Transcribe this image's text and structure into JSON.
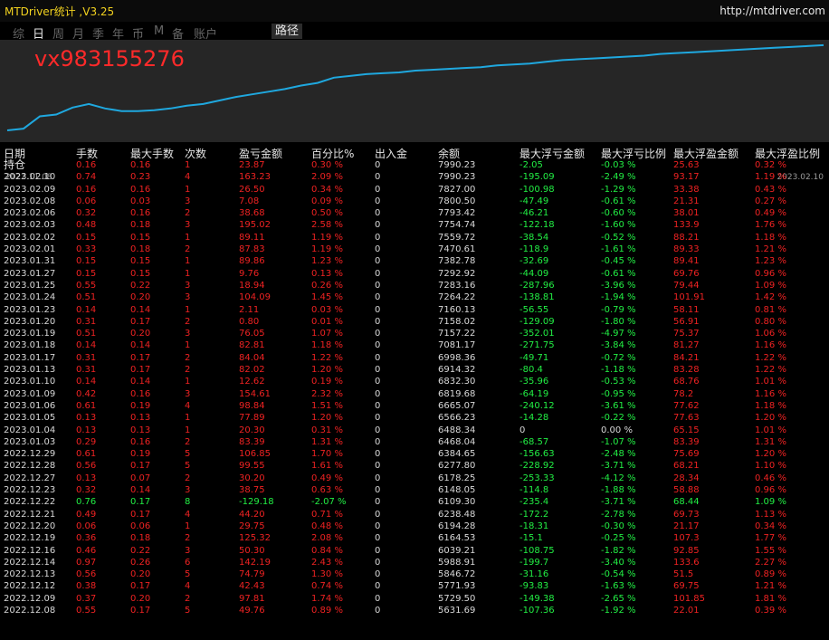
{
  "header": {
    "title": "MTDriver统计 ,V3.25",
    "url": "http://mtdriver.com"
  },
  "tabs": [
    {
      "label": "综",
      "active": false
    },
    {
      "label": "日",
      "active": true
    },
    {
      "label": "周",
      "active": false
    },
    {
      "label": "月",
      "active": false
    },
    {
      "label": "季",
      "active": false
    },
    {
      "label": "年",
      "active": false
    },
    {
      "label": "币",
      "active": false
    },
    {
      "label": "M",
      "active": false
    },
    {
      "label": "备",
      "active": false
    },
    {
      "label": "账户",
      "active": false
    },
    {
      "label": "路径",
      "active": true
    }
  ],
  "watermark": "vx983155276",
  "chart_data": {
    "type": "line",
    "x_start": "2022.11.08",
    "x_end": "2023.02.10",
    "line_color": "#1fa8df",
    "background": "#262626",
    "x": [
      0,
      2,
      4,
      6,
      8,
      10,
      12,
      14,
      16,
      18,
      20,
      22,
      24,
      26,
      28,
      30,
      32,
      34,
      36,
      38,
      40,
      42,
      44,
      46,
      48,
      50,
      52,
      54,
      56,
      58,
      60,
      62,
      64,
      66,
      68,
      70,
      72,
      74,
      76,
      78,
      80,
      82,
      84,
      86,
      88,
      90,
      92,
      94,
      96,
      98,
      100
    ],
    "values": [
      0,
      2,
      16,
      18,
      26,
      30,
      25,
      22,
      22,
      23,
      25,
      28,
      30,
      34,
      38,
      41,
      44,
      47,
      51,
      54,
      60,
      62,
      64,
      65,
      66,
      68,
      69,
      70,
      71,
      72,
      74,
      75,
      76,
      78,
      80,
      81,
      82,
      83,
      84,
      85,
      87,
      88,
      89,
      90,
      91,
      92,
      93,
      94,
      95,
      96,
      97
    ],
    "ylim": [
      0,
      100
    ]
  },
  "table": {
    "columns": [
      "日期",
      "手数",
      "最大手数",
      "次数",
      "盈亏金额",
      "百分比%",
      "出入金",
      "余额",
      "最大浮亏金额",
      "最大浮亏比例",
      "最大浮盈金额",
      "最大浮盈比例"
    ],
    "rows": [
      {
        "cells": [
          "持仓",
          "0.16",
          "0.16",
          "1",
          "23.87",
          "0.30 %",
          "0",
          "7990.23",
          "-2.05",
          "-0.03 %",
          "25.63",
          "0.32 %"
        ],
        "tone": "r"
      },
      {
        "cells": [
          "2023.02.10",
          "0.74",
          "0.23",
          "4",
          "163.23",
          "2.09 %",
          "0",
          "7990.23",
          "-195.09",
          "-2.49 %",
          "93.17",
          "1.19 %"
        ],
        "tone": "r"
      },
      {
        "cells": [
          "2023.02.09",
          "0.16",
          "0.16",
          "1",
          "26.50",
          "0.34 %",
          "0",
          "7827.00",
          "-100.98",
          "-1.29 %",
          "33.38",
          "0.43 %"
        ],
        "tone": "r"
      },
      {
        "cells": [
          "2023.02.08",
          "0.06",
          "0.03",
          "3",
          "7.08",
          "0.09 %",
          "0",
          "7800.50",
          "-47.49",
          "-0.61 %",
          "21.31",
          "0.27 %"
        ],
        "tone": "r"
      },
      {
        "cells": [
          "2023.02.06",
          "0.32",
          "0.16",
          "2",
          "38.68",
          "0.50 %",
          "0",
          "7793.42",
          "-46.21",
          "-0.60 %",
          "38.01",
          "0.49 %"
        ],
        "tone": "r"
      },
      {
        "cells": [
          "2023.02.03",
          "0.48",
          "0.18",
          "3",
          "195.02",
          "2.58 %",
          "0",
          "7754.74",
          "-122.18",
          "-1.60 %",
          "133.9",
          "1.76 %"
        ],
        "tone": "r"
      },
      {
        "cells": [
          "2023.02.02",
          "0.15",
          "0.15",
          "1",
          "89.11",
          "1.19 %",
          "0",
          "7559.72",
          "-38.54",
          "-0.52 %",
          "88.21",
          "1.18 %"
        ],
        "tone": "r"
      },
      {
        "cells": [
          "2023.02.01",
          "0.33",
          "0.18",
          "2",
          "87.83",
          "1.19 %",
          "0",
          "7470.61",
          "-118.9",
          "-1.61 %",
          "89.33",
          "1.21 %"
        ],
        "tone": "r"
      },
      {
        "cells": [
          "2023.01.31",
          "0.15",
          "0.15",
          "1",
          "89.86",
          "1.23 %",
          "0",
          "7382.78",
          "-32.69",
          "-0.45 %",
          "89.41",
          "1.23 %"
        ],
        "tone": "r"
      },
      {
        "cells": [
          "2023.01.27",
          "0.15",
          "0.15",
          "1",
          "9.76",
          "0.13 %",
          "0",
          "7292.92",
          "-44.09",
          "-0.61 %",
          "69.76",
          "0.96 %"
        ],
        "tone": "r"
      },
      {
        "cells": [
          "2023.01.25",
          "0.55",
          "0.22",
          "3",
          "18.94",
          "0.26 %",
          "0",
          "7283.16",
          "-287.96",
          "-3.96 %",
          "79.44",
          "1.09 %"
        ],
        "tone": "r"
      },
      {
        "cells": [
          "2023.01.24",
          "0.51",
          "0.20",
          "3",
          "104.09",
          "1.45 %",
          "0",
          "7264.22",
          "-138.81",
          "-1.94 %",
          "101.91",
          "1.42 %"
        ],
        "tone": "r"
      },
      {
        "cells": [
          "2023.01.23",
          "0.14",
          "0.14",
          "1",
          "2.11",
          "0.03 %",
          "0",
          "7160.13",
          "-56.55",
          "-0.79 %",
          "58.11",
          "0.81 %"
        ],
        "tone": "r"
      },
      {
        "cells": [
          "2023.01.20",
          "0.31",
          "0.17",
          "2",
          "0.80",
          "0.01 %",
          "0",
          "7158.02",
          "-129.09",
          "-1.80 %",
          "56.91",
          "0.80 %"
        ],
        "tone": "r"
      },
      {
        "cells": [
          "2023.01.19",
          "0.51",
          "0.20",
          "3",
          "76.05",
          "1.07 %",
          "0",
          "7157.22",
          "-352.01",
          "-4.97 %",
          "75.37",
          "1.06 %"
        ],
        "tone": "r"
      },
      {
        "cells": [
          "2023.01.18",
          "0.14",
          "0.14",
          "1",
          "82.81",
          "1.18 %",
          "0",
          "7081.17",
          "-271.75",
          "-3.84 %",
          "81.27",
          "1.16 %"
        ],
        "tone": "r"
      },
      {
        "cells": [
          "2023.01.17",
          "0.31",
          "0.17",
          "2",
          "84.04",
          "1.22 %",
          "0",
          "6998.36",
          "-49.71",
          "-0.72 %",
          "84.21",
          "1.22 %"
        ],
        "tone": "r"
      },
      {
        "cells": [
          "2023.01.13",
          "0.31",
          "0.17",
          "2",
          "82.02",
          "1.20 %",
          "0",
          "6914.32",
          "-80.4",
          "-1.18 %",
          "83.28",
          "1.22 %"
        ],
        "tone": "r"
      },
      {
        "cells": [
          "2023.01.10",
          "0.14",
          "0.14",
          "1",
          "12.62",
          "0.19 %",
          "0",
          "6832.30",
          "-35.96",
          "-0.53 %",
          "68.76",
          "1.01 %"
        ],
        "tone": "r"
      },
      {
        "cells": [
          "2023.01.09",
          "0.42",
          "0.16",
          "3",
          "154.61",
          "2.32 %",
          "0",
          "6819.68",
          "-64.19",
          "-0.95 %",
          "78.2",
          "1.16 %"
        ],
        "tone": "r"
      },
      {
        "cells": [
          "2023.01.06",
          "0.61",
          "0.19",
          "4",
          "98.84",
          "1.51 %",
          "0",
          "6665.07",
          "-240.12",
          "-3.61 %",
          "77.62",
          "1.18 %"
        ],
        "tone": "r"
      },
      {
        "cells": [
          "2023.01.05",
          "0.13",
          "0.13",
          "1",
          "77.89",
          "1.20 %",
          "0",
          "6566.23",
          "-14.28",
          "-0.22 %",
          "77.63",
          "1.20 %"
        ],
        "tone": "r"
      },
      {
        "cells": [
          "2023.01.04",
          "0.13",
          "0.13",
          "1",
          "20.30",
          "0.31 %",
          "0",
          "6488.34",
          "0",
          "0.00 %",
          "65.15",
          "1.01 %"
        ],
        "tone": "r"
      },
      {
        "cells": [
          "2023.01.03",
          "0.29",
          "0.16",
          "2",
          "83.39",
          "1.31 %",
          "0",
          "6468.04",
          "-68.57",
          "-1.07 %",
          "83.39",
          "1.31 %"
        ],
        "tone": "r"
      },
      {
        "cells": [
          "2022.12.29",
          "0.61",
          "0.19",
          "5",
          "106.85",
          "1.70 %",
          "0",
          "6384.65",
          "-156.63",
          "-2.48 %",
          "75.69",
          "1.20 %"
        ],
        "tone": "r"
      },
      {
        "cells": [
          "2022.12.28",
          "0.56",
          "0.17",
          "5",
          "99.55",
          "1.61 %",
          "0",
          "6277.80",
          "-228.92",
          "-3.71 %",
          "68.21",
          "1.10 %"
        ],
        "tone": "r"
      },
      {
        "cells": [
          "2022.12.27",
          "0.13",
          "0.07",
          "2",
          "30.20",
          "0.49 %",
          "0",
          "6178.25",
          "-253.33",
          "-4.12 %",
          "28.34",
          "0.46 %"
        ],
        "tone": "r"
      },
      {
        "cells": [
          "2022.12.23",
          "0.32",
          "0.14",
          "3",
          "38.75",
          "0.63 %",
          "0",
          "6148.05",
          "-114.8",
          "-1.88 %",
          "58.88",
          "0.96 %"
        ],
        "tone": "r"
      },
      {
        "cells": [
          "2022.12.22",
          "0.76",
          "0.17",
          "8",
          "-129.18",
          "-2.07 %",
          "0",
          "6109.30",
          "-235.4",
          "-3.71 %",
          "68.44",
          "1.09 %"
        ],
        "tone": "g"
      },
      {
        "cells": [
          "2022.12.21",
          "0.49",
          "0.17",
          "4",
          "44.20",
          "0.71 %",
          "0",
          "6238.48",
          "-172.2",
          "-2.78 %",
          "69.73",
          "1.13 %"
        ],
        "tone": "r"
      },
      {
        "cells": [
          "2022.12.20",
          "0.06",
          "0.06",
          "1",
          "29.75",
          "0.48 %",
          "0",
          "6194.28",
          "-18.31",
          "-0.30 %",
          "21.17",
          "0.34 %"
        ],
        "tone": "r"
      },
      {
        "cells": [
          "2022.12.19",
          "0.36",
          "0.18",
          "2",
          "125.32",
          "2.08 %",
          "0",
          "6164.53",
          "-15.1",
          "-0.25 %",
          "107.3",
          "1.77 %"
        ],
        "tone": "r"
      },
      {
        "cells": [
          "2022.12.16",
          "0.46",
          "0.22",
          "3",
          "50.30",
          "0.84 %",
          "0",
          "6039.21",
          "-108.75",
          "-1.82 %",
          "92.85",
          "1.55 %"
        ],
        "tone": "r"
      },
      {
        "cells": [
          "2022.12.14",
          "0.97",
          "0.26",
          "6",
          "142.19",
          "2.43 %",
          "0",
          "5988.91",
          "-199.7",
          "-3.40 %",
          "133.6",
          "2.27 %"
        ],
        "tone": "r"
      },
      {
        "cells": [
          "2022.12.13",
          "0.56",
          "0.20",
          "5",
          "74.79",
          "1.30 %",
          "0",
          "5846.72",
          "-31.16",
          "-0.54 %",
          "51.5",
          "0.89 %"
        ],
        "tone": "r"
      },
      {
        "cells": [
          "2022.12.12",
          "0.38",
          "0.17",
          "4",
          "42.43",
          "0.74 %",
          "0",
          "5771.93",
          "-93.83",
          "-1.63 %",
          "69.75",
          "1.21 %"
        ],
        "tone": "r"
      },
      {
        "cells": [
          "2022.12.09",
          "0.37",
          "0.20",
          "2",
          "97.81",
          "1.74 %",
          "0",
          "5729.50",
          "-149.38",
          "-2.65 %",
          "101.85",
          "1.81 %"
        ],
        "tone": "r"
      },
      {
        "cells": [
          "2022.12.08",
          "0.55",
          "0.17",
          "5",
          "49.76",
          "0.89 %",
          "0",
          "5631.69",
          "-107.36",
          "-1.92 %",
          "22.01",
          "0.39 %"
        ],
        "tone": "r"
      }
    ]
  }
}
